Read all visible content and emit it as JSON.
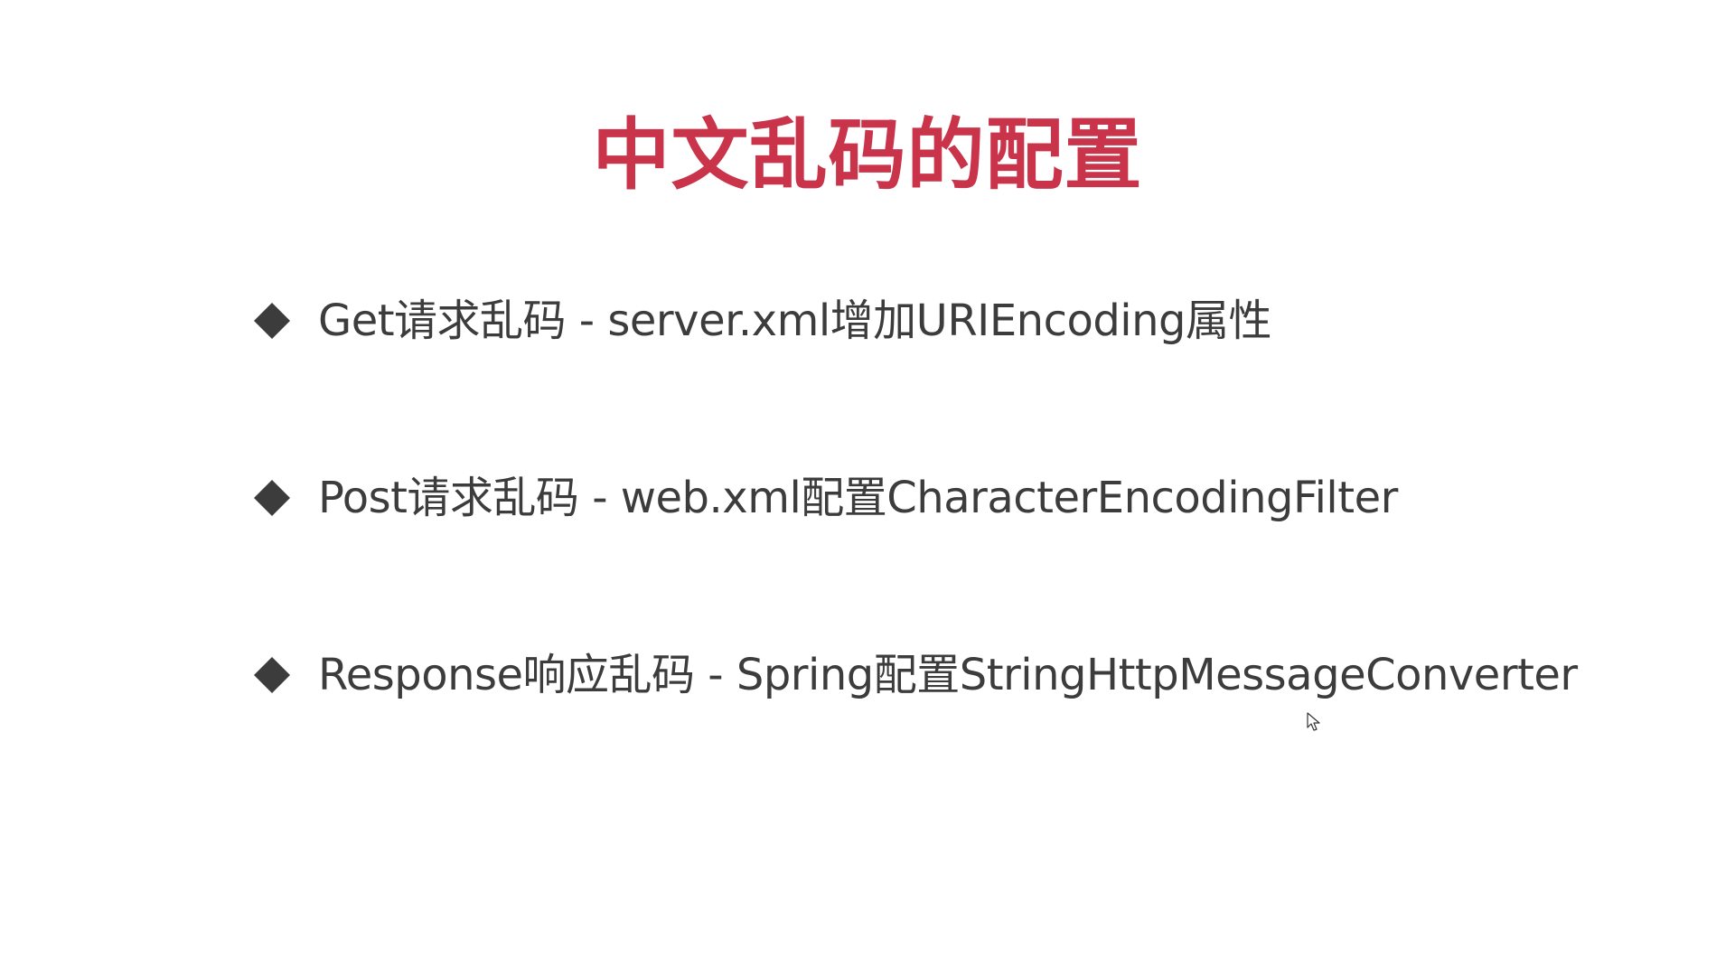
{
  "slide": {
    "title": "中文乱码的配置",
    "title_color": "#c9344b",
    "text_color": "#3c3c3c",
    "bullet_icon": "diamond-bullet-icon",
    "bullets": [
      {
        "text": "Get请求乱码 - server.xml增加URIEncoding属性"
      },
      {
        "text": "Post请求乱码 - web.xml配置CharacterEncodingFilter"
      },
      {
        "text": "Response响应乱码 - Spring配置StringHttpMessageConverter"
      }
    ]
  }
}
